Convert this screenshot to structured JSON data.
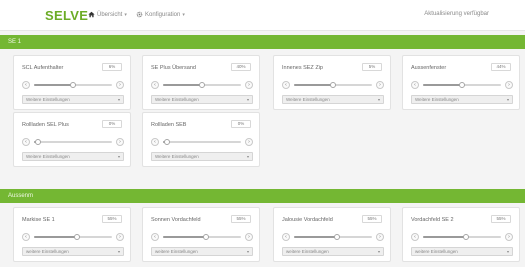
{
  "header": {
    "brand": "SELVE",
    "nav": [
      {
        "label": "Übersicht",
        "icon": "home-icon"
      },
      {
        "label": "Konfiguration",
        "icon": "gear-icon"
      }
    ],
    "status": "Aktualisierung verfügbar"
  },
  "sections": [
    {
      "title": "SE 1",
      "cards": [
        {
          "title": "SCL Aufenthalter",
          "value": "6%",
          "level": 0.5,
          "select": "Weitere Einstellungen"
        },
        {
          "title": "SE Plus Übersand",
          "value": "40%",
          "level": 0.5,
          "select": "Weitere Einstellungen"
        },
        {
          "title": "Innenes SEZ Zip",
          "value": "5%",
          "level": 0.5,
          "select": "Weitere Einstellungen"
        },
        {
          "title": "Aussenfenster",
          "value": "44%",
          "level": 0.5,
          "select": "Weitere Einstellungen"
        },
        {
          "title": "Rollladen SEL Plus",
          "value": "0%",
          "level": 0.05,
          "select": "Weitere Einstellungen"
        },
        {
          "title": "Rollladen SEB",
          "value": "0%",
          "level": 0.05,
          "select": "Weitere Einstellungen"
        }
      ]
    },
    {
      "title": "Aussenm",
      "cards": [
        {
          "title": "Markise SE 1",
          "value": "55%",
          "level": 0.55,
          "select": "weitere Einstellungen"
        },
        {
          "title": "Sonnen Vordachfeld",
          "value": "55%",
          "level": 0.55,
          "select": "weitere Einstellungen"
        },
        {
          "title": "Jalousie Vordachfeld",
          "value": "55%",
          "level": 0.55,
          "select": "weitere Einstellungen"
        },
        {
          "title": "Vordachfeld SE 2",
          "value": "55%",
          "level": 0.55,
          "select": "weitere Einstellungen"
        }
      ]
    }
  ]
}
